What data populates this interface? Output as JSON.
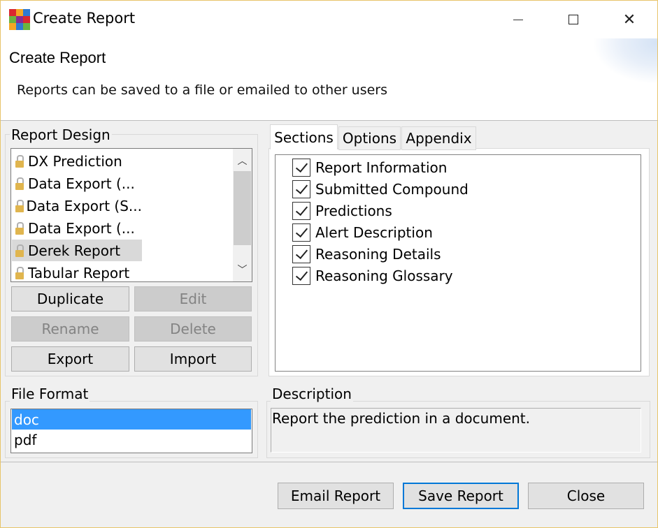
{
  "window": {
    "title": "Create Report",
    "app_icon": "app-logo-icon",
    "controls": {
      "minimize": "minimize-icon",
      "maximize": "maximize-icon",
      "close": "close-icon",
      "close_glyph": "✕"
    }
  },
  "header": {
    "title": "Create Report",
    "subtitle": "Reports can be saved to a file or emailed to other users"
  },
  "report_design": {
    "label": "Report Design",
    "items": [
      {
        "label": "DX Prediction",
        "locked": true
      },
      {
        "label": "Data Export (...",
        "locked": true
      },
      {
        "label": "Data Export (S...",
        "locked": true
      },
      {
        "label": "Data Export (...",
        "locked": true
      },
      {
        "label": "Derek Report",
        "locked": true,
        "selected": true
      },
      {
        "label": "Tabular Report",
        "locked": true
      }
    ],
    "scroll_up": "chevron-up-icon",
    "scroll_down": "chevron-down-icon",
    "scroll_up_glyph": "︿",
    "scroll_down_glyph": "﹀",
    "buttons": {
      "duplicate": "Duplicate",
      "edit": "Edit",
      "rename": "Rename",
      "delete": "Delete",
      "export": "Export",
      "import": "Import"
    }
  },
  "tabs": {
    "items": [
      {
        "label": "Sections",
        "active": true
      },
      {
        "label": "Options",
        "active": false
      },
      {
        "label": "Appendix",
        "active": false
      }
    ],
    "sections": [
      {
        "label": "Report Information",
        "checked": true
      },
      {
        "label": "Submitted Compound",
        "checked": true
      },
      {
        "label": "Predictions",
        "checked": true
      },
      {
        "label": "Alert Description",
        "checked": true
      },
      {
        "label": "Reasoning Details",
        "checked": true
      },
      {
        "label": "Reasoning Glossary",
        "checked": true
      }
    ]
  },
  "file_format": {
    "label": "File Format",
    "options": [
      {
        "label": "doc",
        "selected": true
      },
      {
        "label": "pdf",
        "selected": false
      }
    ]
  },
  "description": {
    "label": "Description",
    "text": "Report the prediction in a document."
  },
  "footer": {
    "email": "Email Report",
    "save": "Save Report",
    "close": "Close"
  },
  "colors": {
    "selection": "#3399ff",
    "list_selected_inactive": "#d9d9d9",
    "window_border": "#e8c46a",
    "default_button_border": "#0078d7",
    "lock": "#e0b54e"
  }
}
